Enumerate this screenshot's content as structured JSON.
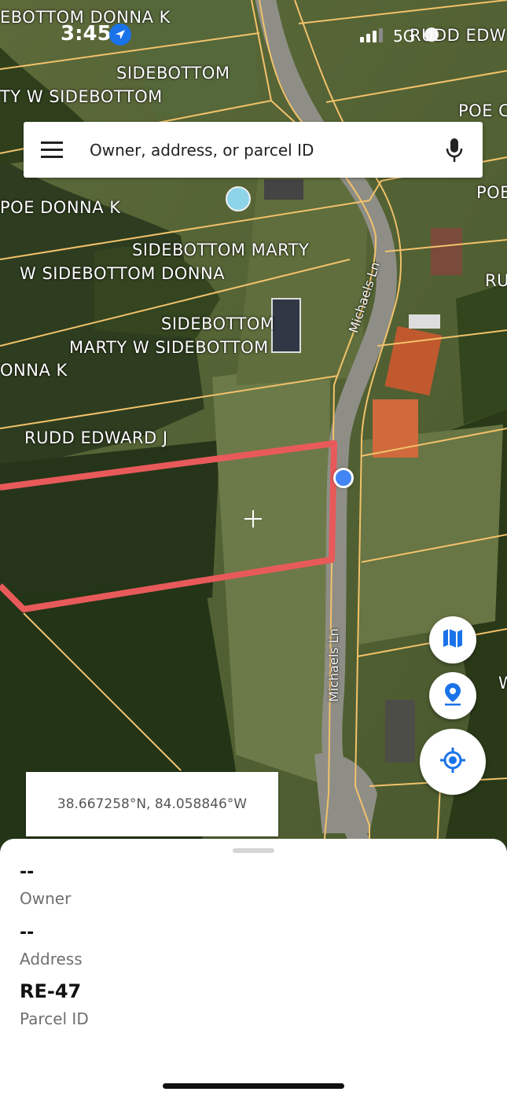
{
  "status_bar": {
    "time": "3:45",
    "network": "5G"
  },
  "map": {
    "labels": [
      "EBOTTOM DONNA K",
      "SIDEBOTTOM",
      "TY W SIDEBOTTOM",
      "POE C",
      "RUDD EDW",
      "POE",
      "POE DONNA K",
      "SIDEBOTTOM MARTY",
      "W SIDEBOTTOM DONNA",
      "RU",
      "SIDEBOTTOM",
      "MARTY W SIDEBOTTOM",
      "ONNA K",
      "RUDD EDWARD J",
      "W"
    ],
    "roads": [
      "Michaels Ln",
      "Michaels Ln"
    ]
  },
  "search": {
    "placeholder": "Owner, address, or parcel ID"
  },
  "coordinates": "38.667258°N, 84.058846°W",
  "parcel": {
    "owner": {
      "value": "--",
      "label": "Owner"
    },
    "address": {
      "value": "--",
      "label": "Address"
    },
    "parcel_id": {
      "value": "RE-47",
      "label": "Parcel ID"
    }
  },
  "icons": {
    "location_arrow": "location-arrow-icon",
    "menu": "hamburger-menu-icon",
    "mic": "microphone-icon",
    "map_layers": "map-layers-icon",
    "pin": "map-pin-icon",
    "locate": "my-location-icon",
    "crosshair": "crosshair-icon"
  },
  "colors": {
    "parcel_line": "#f2c26b",
    "selected_parcel": "#e85a5a",
    "accent_blue": "#1a73e8",
    "user_location": "#4285f4"
  }
}
